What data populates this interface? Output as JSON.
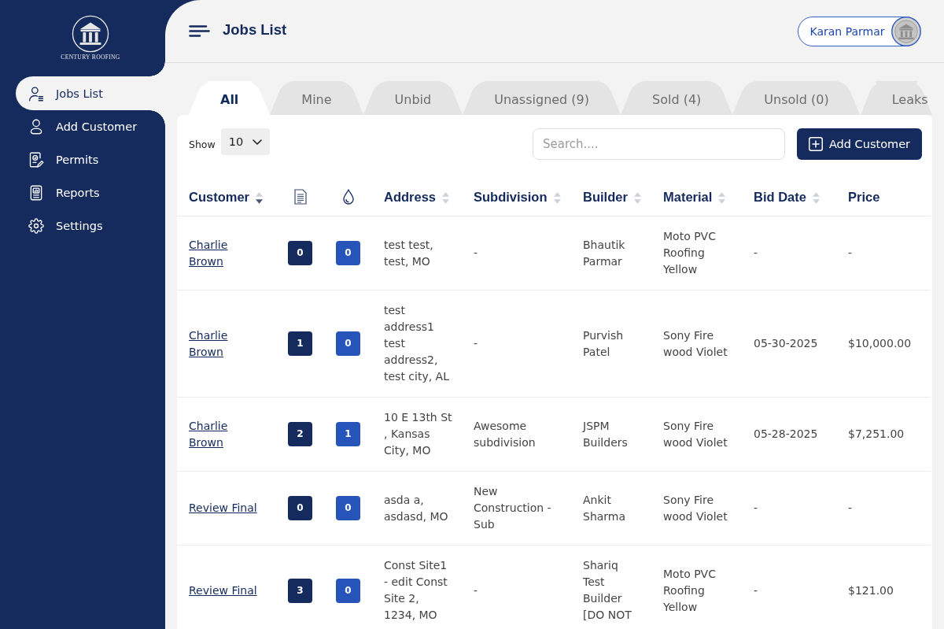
{
  "sidebar": {
    "logo_text": "CENTURY ROOFING",
    "items": [
      {
        "label": "Jobs List",
        "selected": true
      },
      {
        "label": "Add Customer",
        "selected": false
      },
      {
        "label": "Permits",
        "selected": false
      },
      {
        "label": "Reports",
        "selected": false
      },
      {
        "label": "Settings",
        "selected": false
      }
    ]
  },
  "header": {
    "title": "Jobs List",
    "user_name": "Karan Parmar"
  },
  "tabs": [
    {
      "label": "All",
      "selected": true
    },
    {
      "label": "Mine",
      "selected": false
    },
    {
      "label": "Unbid",
      "selected": false
    },
    {
      "label": "Unassigned (9)",
      "selected": false
    },
    {
      "label": "Sold (4)",
      "selected": false
    },
    {
      "label": "Unsold (0)",
      "selected": false
    },
    {
      "label": "Leaks",
      "selected": false
    }
  ],
  "toolbar": {
    "show_label": "Show",
    "page_size": "10",
    "search": {
      "placeholder": "Search...."
    },
    "add_button": "Add Customer"
  },
  "table": {
    "columns": [
      {
        "label": "Customer",
        "kind": "link",
        "sortable": true,
        "sorted": true
      },
      {
        "kind": "file",
        "sortable": false,
        "sorted": false
      },
      {
        "kind": "drop",
        "sortable": false,
        "sorted": false
      },
      {
        "label": "Address",
        "kind": "text",
        "sortable": true,
        "sorted": false
      },
      {
        "label": "Subdivision",
        "kind": "text",
        "sortable": true,
        "sorted": false
      },
      {
        "label": "Builder",
        "kind": "text",
        "sortable": true,
        "sorted": false
      },
      {
        "label": "Material",
        "kind": "text",
        "sortable": true,
        "sorted": false
      },
      {
        "label": "Bid Date",
        "kind": "text",
        "sortable": true,
        "sorted": false
      },
      {
        "label": "Price",
        "kind": "text",
        "sortable": false,
        "sorted": false
      }
    ],
    "rows": [
      {
        "cells": [
          "Charlie Brown",
          "0",
          "0",
          "test test, test, MO",
          "-",
          "Bhautik Parmar",
          "Moto PVC Roofing Yellow",
          "-",
          "-"
        ]
      },
      {
        "cells": [
          "Charlie Brown",
          "1",
          "0",
          "test address1 test address2, test city, AL",
          "-",
          "Purvish Patel",
          "Sony Fire wood Violet",
          "05-30-2025",
          "$10,000.00"
        ]
      },
      {
        "cells": [
          "Charlie Brown",
          "2",
          "1",
          "10 E 13th St , Kansas City, MO",
          "Awesome subdivision",
          "JSPM Builders",
          "Sony Fire wood Violet",
          "05-28-2025",
          "$7,251.00"
        ]
      },
      {
        "cells": [
          "Review Final",
          "0",
          "0",
          "asda a, asdasd, MO",
          "New Construction - Sub",
          "Ankit Sharma",
          "Sony Fire wood Violet",
          "-",
          "-"
        ]
      },
      {
        "cells": [
          "Review Final",
          "3",
          "0",
          "Const Site1 - edit Const Site 2, 1234, MO",
          "-",
          "Shariq Test Builder [DO NOT",
          "Moto PVC Roofing Yellow",
          "-",
          "$121.00"
        ]
      }
    ]
  }
}
